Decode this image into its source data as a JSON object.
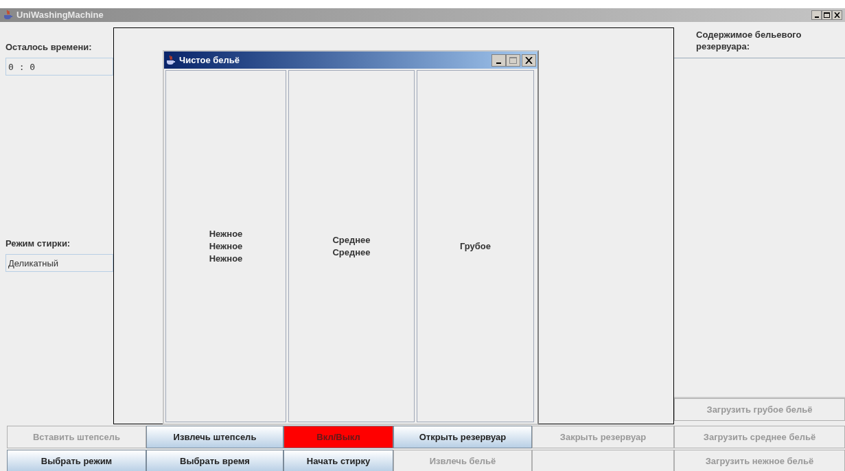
{
  "window": {
    "title": "UniWashingMachine"
  },
  "left_panel": {
    "time_label": "Осталось времени:",
    "time_field": {
      "value": "0 : 0"
    },
    "mode_label": "Режим стирки:",
    "mode_field": {
      "value": "Деликатный"
    }
  },
  "inner_window": {
    "title": "Чистое бельё",
    "columns": [
      {
        "lines": [
          "Нежное",
          "Нежное",
          "Нежное"
        ]
      },
      {
        "lines": [
          "Среднее",
          "Среднее"
        ]
      },
      {
        "lines": [
          "Грубое"
        ]
      }
    ]
  },
  "right_panel": {
    "label": "Содержимое бельевого резервуара:",
    "button": {
      "label": "Загрузить грубое бельё",
      "disabled": true
    }
  },
  "buttons": [
    {
      "kind": "button",
      "label": "Вставить штепсель",
      "disabled": true
    },
    {
      "kind": "button",
      "label": "Извлечь штепсель",
      "disabled": false
    },
    {
      "kind": "button",
      "label": "Вкл/Выкл",
      "disabled": true,
      "color": "#ff0000"
    },
    {
      "kind": "button",
      "label": "Открыть резервуар",
      "disabled": false
    },
    {
      "kind": "button",
      "label": "Закрыть резервуар",
      "disabled": true
    },
    {
      "kind": "button",
      "label": "Загрузить среднее бельё",
      "disabled": true
    },
    {
      "kind": "button",
      "label": "Выбрать режим",
      "disabled": false
    },
    {
      "kind": "button",
      "label": "Выбрать время",
      "disabled": false
    },
    {
      "kind": "button",
      "label": "Начать стирку",
      "disabled": false
    },
    {
      "kind": "button",
      "label": "Извлечь бельё",
      "disabled": true
    },
    {
      "kind": "empty"
    },
    {
      "kind": "button",
      "label": "Загрузить нежное бельё",
      "disabled": true
    }
  ]
}
